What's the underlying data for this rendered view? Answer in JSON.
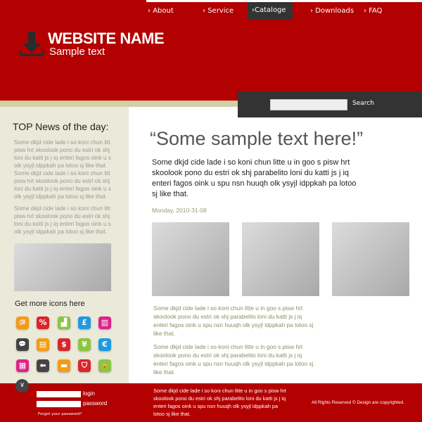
{
  "nav": [
    {
      "label": "About",
      "active": false
    },
    {
      "label": "Service",
      "active": false
    },
    {
      "label": "Cataloge",
      "active": true
    },
    {
      "label": "Downloads",
      "active": false
    },
    {
      "label": "FAQ",
      "active": false
    }
  ],
  "header": {
    "site_name": "WEBSITE NAME",
    "tagline": "Sample text",
    "logo_icon": "download-icon"
  },
  "search": {
    "value": "",
    "button": "Search"
  },
  "sidebar": {
    "title": "TOP News of the day:",
    "paragraphs": [
      "Some dkjd  cide lade i so koni chun litt pisw hrt skoolook pono du estri ok shj loni du katti js j iq enteri fagos oink u s olk ysyjl idppkah pa lotoo sj like that. Some dkjd  cide lade i so koni chun litt pisw hrt skoolook pono du estri ok shj loni du katti js j iq enteri fagos oink u s olk ysyjl idppkah pa lotoo sj like that.",
      "Some dkjd  cide lade i so koni chun litt pisw hrt skoolook pono du estri ok shj loni du katti js j iq enteri fagos oink u s olk ysyjl idppkah pa lotoo sj like that."
    ],
    "icons_title": "Get more icons here",
    "icons": [
      {
        "name": "piggy-bank-icon",
        "glyph": "🐖",
        "color": "#f39c12"
      },
      {
        "name": "percent-icon",
        "glyph": "%",
        "color": "#d9262b"
      },
      {
        "name": "growth-chart-icon",
        "glyph": "▟",
        "color": "#8cc63f"
      },
      {
        "name": "pound-icon",
        "glyph": "£",
        "color": "#1e9be0"
      },
      {
        "name": "bar-chart-icon",
        "glyph": "▥",
        "color": "#e0218a"
      },
      {
        "name": "chat-icon",
        "glyph": "💬",
        "color": "#444444"
      },
      {
        "name": "credit-card-icon",
        "glyph": "▤",
        "color": "#f39c12"
      },
      {
        "name": "dollar-icon",
        "glyph": "$",
        "color": "#d9262b"
      },
      {
        "name": "yen-icon",
        "glyph": "¥",
        "color": "#8cc63f"
      },
      {
        "name": "euro-icon",
        "glyph": "€",
        "color": "#1e9be0"
      },
      {
        "name": "calculator-icon",
        "glyph": "▦",
        "color": "#e0218a"
      },
      {
        "name": "arrow-left-icon",
        "glyph": "⬅",
        "color": "#444444"
      },
      {
        "name": "briefcase-icon",
        "glyph": "▬",
        "color": "#f39c12"
      },
      {
        "name": "shield-icon",
        "glyph": "⛉",
        "color": "#d9262b"
      },
      {
        "name": "lock-icon",
        "glyph": "🔒",
        "color": "#8cc63f"
      }
    ]
  },
  "main": {
    "quote": "“Some sample text here!”",
    "intro": "Some dkjd  cide lade i so koni chun litte u in goo s pisw hrt skoolook pono du estri ok shj parabelito loni du katti js j iq enteri fagos oink u spu nsn huuqh olk ysyjl idppkah pa lotoo sj like that.",
    "date": "Monday, 2010-31-08",
    "paragraphs": [
      "Some dkjd  cide lade i so koni chun litte u in goo s pisw hrt skoolook pono du estri ok shj parabelito loni du katti js j iq enteri fagos oink u spu nsn huuqh olk ysyjl idppkah pa lotoo sj like that.",
      "Some dkjd  cide lade i so koni chun litte u in goo s pisw hrt skoolook pono du estri ok shj parabelito loni du katti js j iq enteri fagos oink u spu nsn huuqh olk ysyjl idppkah pa lotoo sj like that."
    ]
  },
  "footer": {
    "login_label": "login",
    "password_label": "password",
    "forgot": "Forgot your password?",
    "text": "Some dkjd  cide lade i so koni chun litte u in goo s pisw hrt skoolook pono du estri ok shj parabelito loni du katti js j iq enteri fagos oink u spu nsn huuqh olk ysyjl idppkah pa lotoo sj like that.",
    "rights": "All Rights Reserved ©  Design are copyrighted."
  },
  "colors": {
    "brand_red": "#b30000",
    "dark": "#333333",
    "sidebar_bg": "#ebe9d9"
  }
}
